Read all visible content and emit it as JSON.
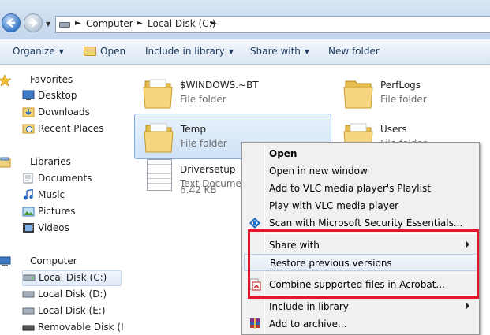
{
  "address": {
    "crumbs": [
      "Computer",
      "Local Disk (C:)"
    ]
  },
  "toolbar": {
    "organize": "Organize",
    "open": "Open",
    "include_in_library": "Include in library",
    "share_with": "Share with",
    "new_folder": "New folder"
  },
  "navpane": {
    "favorites": {
      "label": "Favorites",
      "items": [
        "Desktop",
        "Downloads",
        "Recent Places"
      ]
    },
    "libraries": {
      "label": "Libraries",
      "items": [
        "Documents",
        "Music",
        "Pictures",
        "Videos"
      ]
    },
    "computer": {
      "label": "Computer",
      "items": [
        "Local Disk (C:)",
        "Local Disk (D:)",
        "Local Disk (E:)",
        "Removable Disk (I:)"
      ]
    }
  },
  "files": [
    {
      "name": "$WINDOWS.~BT",
      "type": "File folder"
    },
    {
      "name": "PerfLogs",
      "type": "File folder"
    },
    {
      "name": "Temp",
      "type": "File folder"
    },
    {
      "name": "Users",
      "type": "File folder"
    },
    {
      "name": "Driversetup",
      "type": "Text Documen",
      "size": "6.42 KB"
    }
  ],
  "context_menu": {
    "items": [
      "Open",
      "Open in new window",
      "Add to VLC media player's Playlist",
      "Play with VLC media player",
      "Scan with Microsoft Security Essentials...",
      "Share with",
      "Restore previous versions",
      "Combine supported files in Acrobat...",
      "Include in library",
      "Add to archive..."
    ]
  },
  "colors": {
    "highlight_box": "#e5162a",
    "selection": "#cfe2f7",
    "toolbar_text": "#1e3a5f"
  }
}
